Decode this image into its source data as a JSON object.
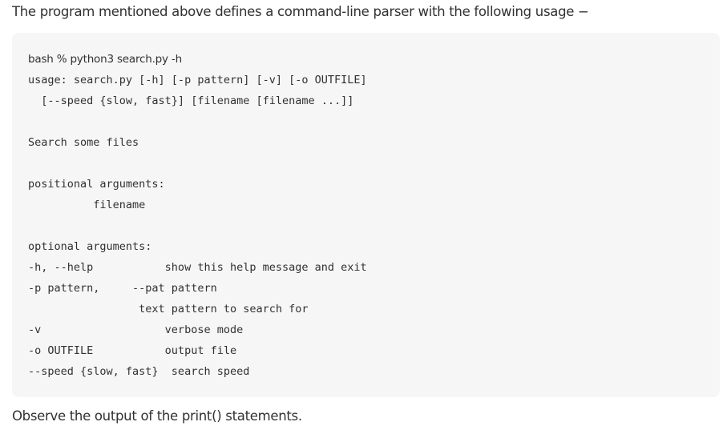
{
  "intro_text": "The program mentioned above defines a command-line parser with the following usage −",
  "code": {
    "lines": [
      "bash % python3 search.py -h",
      "usage: search.py [-h] [-p pattern] [-v] [-o OUTFILE]",
      "  [--speed {slow, fast}] [filename [filename ...]]",
      "",
      "Search some files",
      "",
      "positional arguments:",
      "          filename",
      "",
      "optional arguments:",
      "-h, --help           show this help message and exit",
      "-p pattern,     --pat pattern",
      "                 text pattern to search for",
      "-v                   verbose mode",
      "-o OUTFILE           output file",
      "--speed {slow, fast}  search speed"
    ]
  },
  "outro_text": "Observe the output of the print() statements."
}
